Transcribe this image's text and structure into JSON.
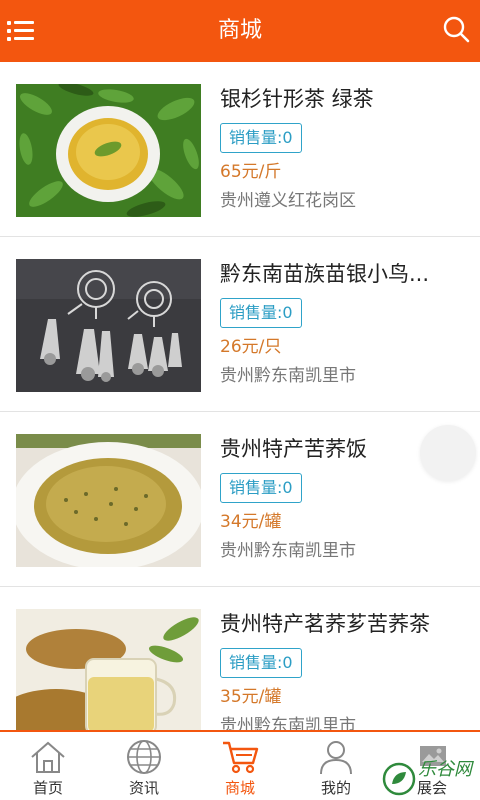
{
  "header": {
    "title": "商城",
    "menu_icon": "list-menu-icon",
    "search_icon": "search-icon",
    "bg_color": "#f3560f"
  },
  "products": [
    {
      "name": "银杉针形茶 绿茶",
      "sales": "销售量:0",
      "price": "65元/斤",
      "location": "贵州遵义红花岗区"
    },
    {
      "name": "黔东南苗族苗银小鸟...",
      "sales": "销售量:0",
      "price": "26元/只",
      "location": "贵州黔东南凯里市"
    },
    {
      "name": "贵州特产苦荞饭",
      "sales": "销售量:0",
      "price": "34元/罐",
      "location": "贵州黔东南凯里市"
    },
    {
      "name": "贵州特产茗荞芗苦荞茶",
      "sales": "销售量:0",
      "price": "35元/罐",
      "location": "贵州黔东南凯里市"
    }
  ],
  "tabs": [
    {
      "label": "首页",
      "icon": "home-icon",
      "active": false
    },
    {
      "label": "资讯",
      "icon": "globe-icon",
      "active": false
    },
    {
      "label": "商城",
      "icon": "cart-icon",
      "active": true
    },
    {
      "label": "我的",
      "icon": "user-icon",
      "active": false
    },
    {
      "label": "展会",
      "icon": "exhibition-icon",
      "active": false
    }
  ],
  "watermark": {
    "text": "乐谷网"
  },
  "colors": {
    "accent": "#f3560f",
    "sales_border": "#2fa3c9",
    "price": "#d4782a"
  }
}
